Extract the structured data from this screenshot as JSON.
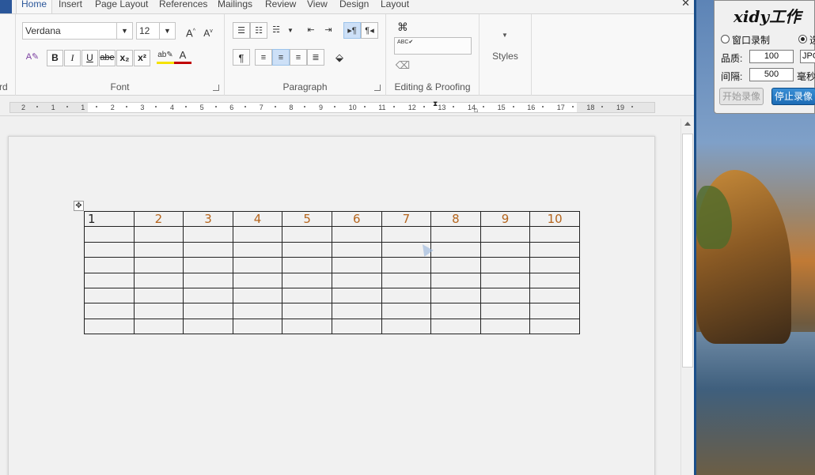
{
  "word": {
    "tabs": [
      "Home",
      "Insert",
      "Page Layout",
      "References",
      "Mailings",
      "Review",
      "View",
      "Design",
      "Layout"
    ],
    "active_tab": "Home",
    "clipboard_label_fragment": "rd",
    "font": {
      "family": "Verdana",
      "size": "12",
      "grow_label": "A",
      "shrink_label": "A",
      "bold": "B",
      "italic": "I",
      "underline": "U",
      "strike": "abe",
      "subscript": "x₂",
      "superscript": "x²",
      "font_color_label": "A",
      "group_label": "Font"
    },
    "paragraph": {
      "group_label": "Paragraph"
    },
    "editing": {
      "group_label": "Editing & Proofing"
    },
    "styles": {
      "label": "Styles"
    },
    "ruler_numbers": [
      "2",
      "1",
      "1",
      "2",
      "3",
      "4",
      "5",
      "6",
      "7",
      "8",
      "9",
      "10",
      "11",
      "12",
      "13",
      "14",
      "15",
      "16",
      "17",
      "18",
      "19"
    ],
    "table": {
      "header": [
        "1",
        "2",
        "3",
        "4",
        "5",
        "6",
        "7",
        "8",
        "9",
        "10"
      ],
      "empty_rows": 7
    }
  },
  "recorder": {
    "title": "xidy工作",
    "mode_window": "窗口录制",
    "mode_other_fragment": "选",
    "quality_label": "品质:",
    "quality_value": "100",
    "format_value": "JPG",
    "interval_label": "间隔:",
    "interval_value": "500",
    "interval_unit": "毫秒",
    "start_button": "开始录像",
    "stop_button": "停止录像"
  },
  "colors": {
    "accent_blue": "#2b579a",
    "table_number_orange": "#b5651d"
  }
}
